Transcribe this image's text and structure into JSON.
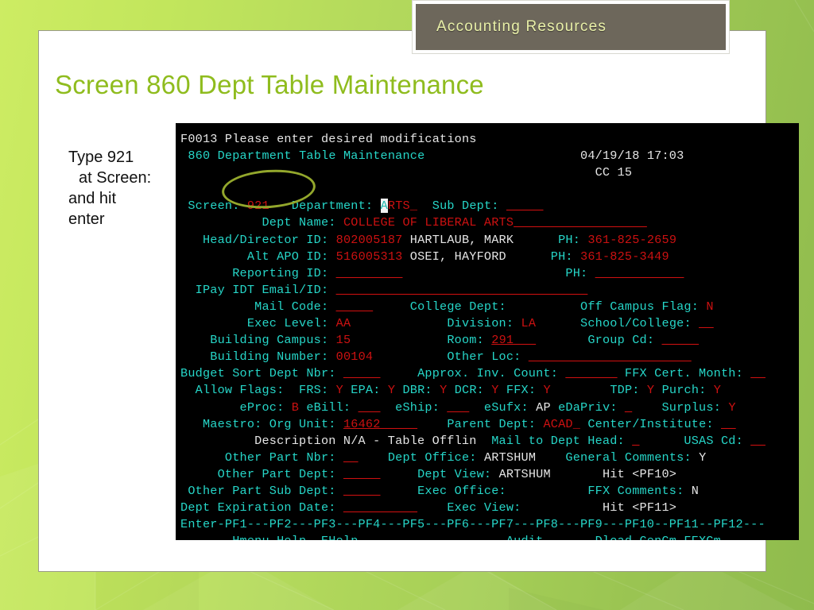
{
  "slide": {
    "banner_title": "Accounting Resources",
    "title": "Screen 860 Dept Table Maintenance",
    "annotation": {
      "line1": "Type 921",
      "line2": "at Screen:",
      "line3": "and hit",
      "line4": "enter"
    },
    "colors": {
      "title_green": "#8fbc1e",
      "banner_bg": "#6d675b",
      "banner_text": "#e9f0a8",
      "background_green": "#b3d95c",
      "ellipse": "#93a72c"
    }
  },
  "terminal": {
    "colors": {
      "background": "#000000",
      "label_cyan": "#26d6c8",
      "value_red": "#cc1111",
      "value_white": "#e6e6e6",
      "cursor_bg": "#f2f2f2"
    },
    "message_code": "F0013",
    "message_text": "Please enter desired modifications",
    "screen_number": "860",
    "screen_title": "Department Table Maintenance",
    "datetime": "04/19/18 17:03",
    "cc": "CC 15",
    "fields": {
      "screen": "921",
      "department": "ARTS_",
      "department_cursor_char": "A",
      "department_rest": "RTS_",
      "sub_dept": "_____",
      "dept_name": "COLLEGE OF LIBERAL ARTS",
      "dept_name_pad": "__________________",
      "head_director_id": "802005187",
      "head_director_name": "HARTLAUB, MARK",
      "head_director_ph": "361-825-2659",
      "alt_apo_id": "516005313",
      "alt_apo_name": "OSEI, HAYFORD",
      "alt_apo_ph": "361-825-3449",
      "reporting_id": "_________",
      "reporting_ph": "____________",
      "ipay_idt_email_id": "__________________________________",
      "mail_code": "_____",
      "college_dept": "",
      "off_campus_flag": "N",
      "exec_level": "AA",
      "division": "LA",
      "school_college": "__",
      "building_campus": "15",
      "room": "291___",
      "group_cd": "_____",
      "building_number": "00104",
      "other_loc": "______________________",
      "budget_sort_dept_nbr": "_____",
      "approx_inv_count": "_______",
      "ffx_cert_month": "__",
      "allow_flags_label": "Allow Flags:",
      "frs": "Y",
      "epa": "Y",
      "dbr": "Y",
      "dcr": "Y",
      "ffx": "Y",
      "tdp": "Y",
      "purch": "Y",
      "eproc": "B",
      "ebill": "___",
      "eship": "___",
      "esufx": "AP",
      "edapriv": "_",
      "surplus": "Y",
      "maestro_org_unit": "16462_____",
      "parent_dept": "ACAD_",
      "center_institute": "__",
      "description": "Description N/A - Table Offlin",
      "mail_to_dept_head": "_",
      "usas_cd": "__",
      "other_part_nbr": "__",
      "dept_office": "ARTSHUM",
      "general_comments": "Y",
      "other_part_dept": "_____",
      "dept_view": "ARTSHUM",
      "hit_pf10": "Hit <PF10>",
      "other_part_sub_dept": "_____",
      "exec_office": "",
      "ffx_comments": "N",
      "dept_expiration_date": "__________",
      "exec_view": "",
      "hit_pf11": "Hit <PF11>"
    },
    "labels": {
      "screen": "Screen:",
      "department": "Department:",
      "sub_dept": "Sub Dept:",
      "dept_name": "Dept Name:",
      "head_director_id": "Head/Director ID:",
      "alt_apo_id": "Alt APO ID:",
      "reporting_id": "Reporting ID:",
      "ipay": "IPay IDT Email/ID:",
      "mail_code": "Mail Code:",
      "college_dept": "College Dept:",
      "off_campus_flag": "Off Campus Flag:",
      "exec_level": "Exec Level:",
      "division": "Division:",
      "school_college": "School/College:",
      "building_campus": "Building Campus:",
      "room": "Room:",
      "group_cd": "Group Cd:",
      "building_number": "Building Number:",
      "other_loc": "Other Loc:",
      "budget_sort": "Budget Sort Dept Nbr:",
      "approx_inv": "Approx. Inv. Count:",
      "ffx_cert_month": "FFX Cert. Month:",
      "ph": "PH:",
      "maestro": "Maestro: Org Unit:",
      "parent_dept": "Parent Dept:",
      "center_institute": "Center/Institute:",
      "mail_to_dept_head": "Mail to Dept Head:",
      "usas_cd": "USAS Cd:",
      "other_part_nbr": "Other Part Nbr:",
      "dept_office": "Dept Office:",
      "general_comments": "General Comments:",
      "other_part_dept": "Other Part Dept:",
      "dept_view": "Dept View:",
      "other_part_sub_dept": "Other Part Sub Dept:",
      "exec_office": "Exec Office:",
      "ffx_comments": "FFX Comments:",
      "dept_expiration_date": "Dept Expiration Date:",
      "exec_view": "Exec View:"
    },
    "pf_bar": "Enter-PF1---PF2---PF3---PF4---PF5---PF6---PF7---PF8---PF9---PF10--PF11--PF12---",
    "pf_keys": "       Hmenu Help  EHelp                    Audit       Dload GenCm FFXCm"
  }
}
